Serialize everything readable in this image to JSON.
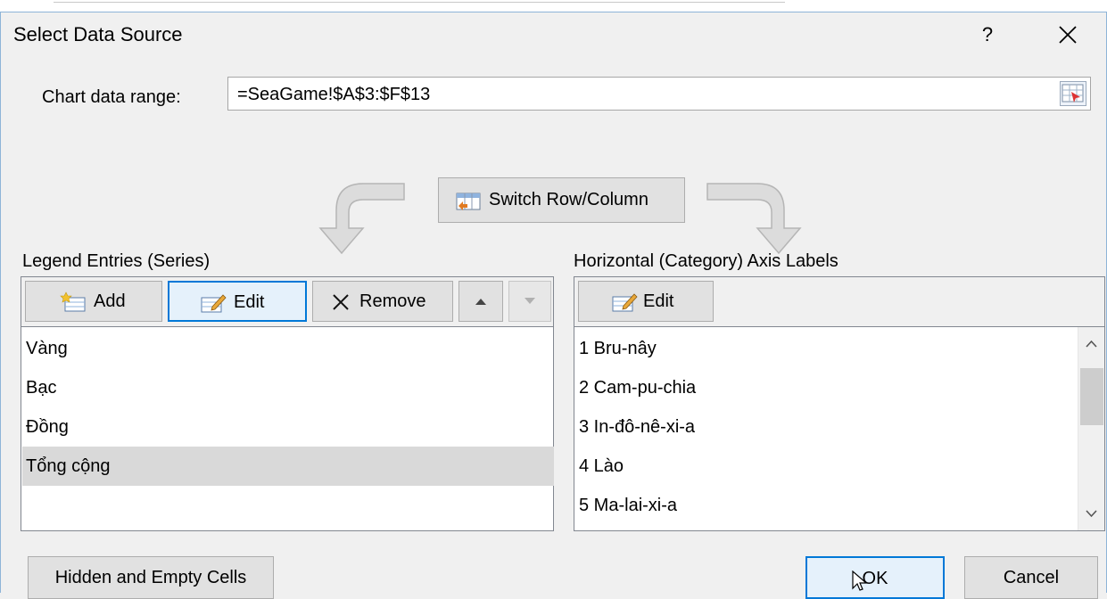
{
  "dialog": {
    "title": "Select Data Source",
    "help_label": "?",
    "close_label": "✕"
  },
  "range": {
    "label": "Chart data range:",
    "value": "=SeaGame!$A$3:$F$13"
  },
  "switch_button": {
    "label": "Switch Row/Column"
  },
  "legend": {
    "heading": "Legend Entries (Series)",
    "toolbar": {
      "add": "Add",
      "edit": "Edit",
      "remove": "Remove"
    },
    "items": [
      "Vàng",
      "Bạc",
      "Đồng",
      "Tổng cộng"
    ],
    "selected_index": 3
  },
  "axis": {
    "heading": "Horizontal (Category) Axis Labels",
    "toolbar": {
      "edit": "Edit"
    },
    "items": [
      "1 Bru-nây",
      "2 Cam-pu-chia",
      "3 In-đô-nê-xi-a",
      "4 Lào",
      "5 Ma-lai-xi-a"
    ]
  },
  "buttons": {
    "hidden_empty": "Hidden and Empty Cells",
    "ok": "OK",
    "cancel": "Cancel"
  },
  "icons": {
    "range_picker": "range-picker-icon",
    "switch": "switch-row-column-icon",
    "add": "add-icon",
    "edit": "edit-icon",
    "remove": "remove-icon",
    "move_up": "triangle-up-icon",
    "move_down": "triangle-down-icon"
  },
  "colors": {
    "accent": "#0078d7",
    "selection": "#d9d9d9",
    "dialog_bg": "#f0f0f0"
  }
}
